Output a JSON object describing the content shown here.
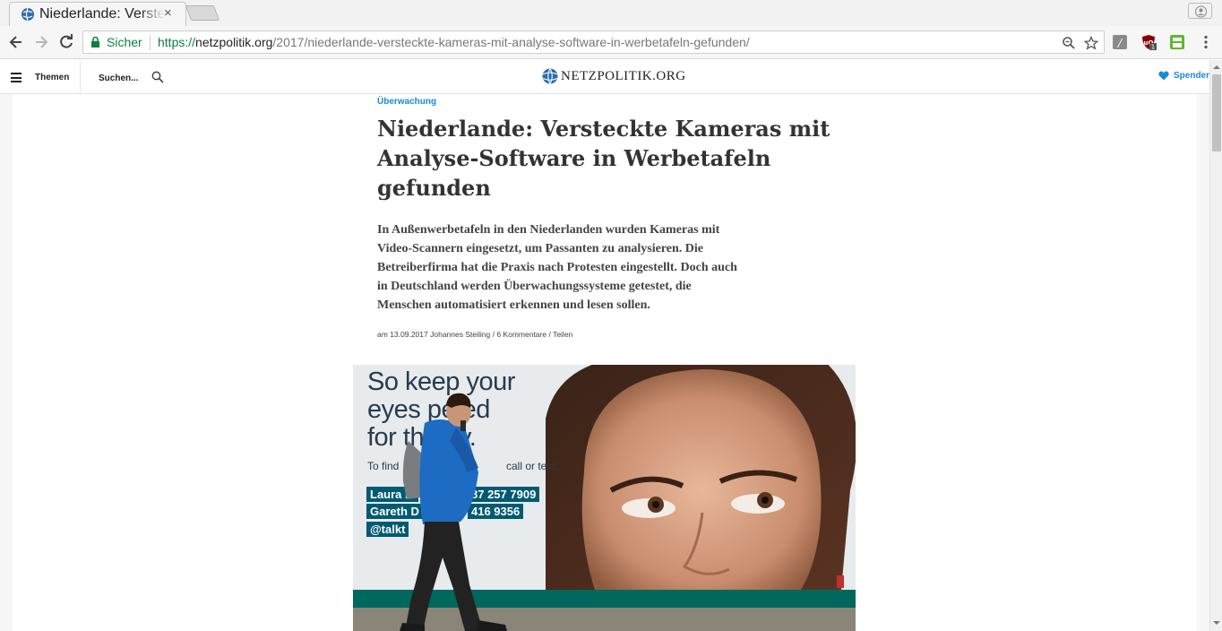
{
  "browser": {
    "tab_title": "Niederlande: Versteckte Kameras mit Analyse-Software in Werbetafeln gefunden",
    "tab_close": "×",
    "secure_label": "Sicher",
    "url_scheme": "https://",
    "url_host": "netzpolitik.org",
    "url_path": "/2017/niederlande-versteckte-kameras-mit-analyse-software-in-werbetafeln-gefunden/",
    "extension_badge": "1",
    "colors": {
      "secure_green": "#0b8043",
      "chrome_bg": "#f6f6f6"
    }
  },
  "site_header": {
    "menu_label": "Themen",
    "search_placeholder": "Suchen...",
    "logo_text": "NETZPOLITIK.ORG",
    "donate_label": "Spenden",
    "colors": {
      "accent_blue": "#1a8ad8"
    }
  },
  "article": {
    "category": "Überwachung",
    "headline": "Niederlande: Versteckte Kameras mit Analyse-Software in Werbetafeln gefunden",
    "teaser": "In Außenwerbetafeln in den Niederlanden wurden Kameras mit Video-Scannern eingesetzt, um Passanten zu analysieren. Die Betreiberfirma hat die Praxis nach Protesten eingestellt. Doch auch in Deutschland werden Überwachungssysteme getestet, die Menschen automatisiert erkennen und lesen sollen.",
    "meta": {
      "prefix": "am",
      "date": "13.09.2017",
      "author": "Johannes Steiling",
      "comments": "6 Kommentare",
      "share": "Teilen",
      "separator": "/"
    },
    "hero_image": {
      "billboard_line1": "So keep your",
      "billboard_line2": "eyes pe     ed",
      "billboard_line3": "for th        day.",
      "small_left": "To find",
      "small_right": "call or text:",
      "bar1_left": "Laura M",
      "bar1_right": "87 257 7909",
      "bar2_left": "Gareth D",
      "bar2_right": "416 9356",
      "bar3": "@talkt"
    }
  }
}
